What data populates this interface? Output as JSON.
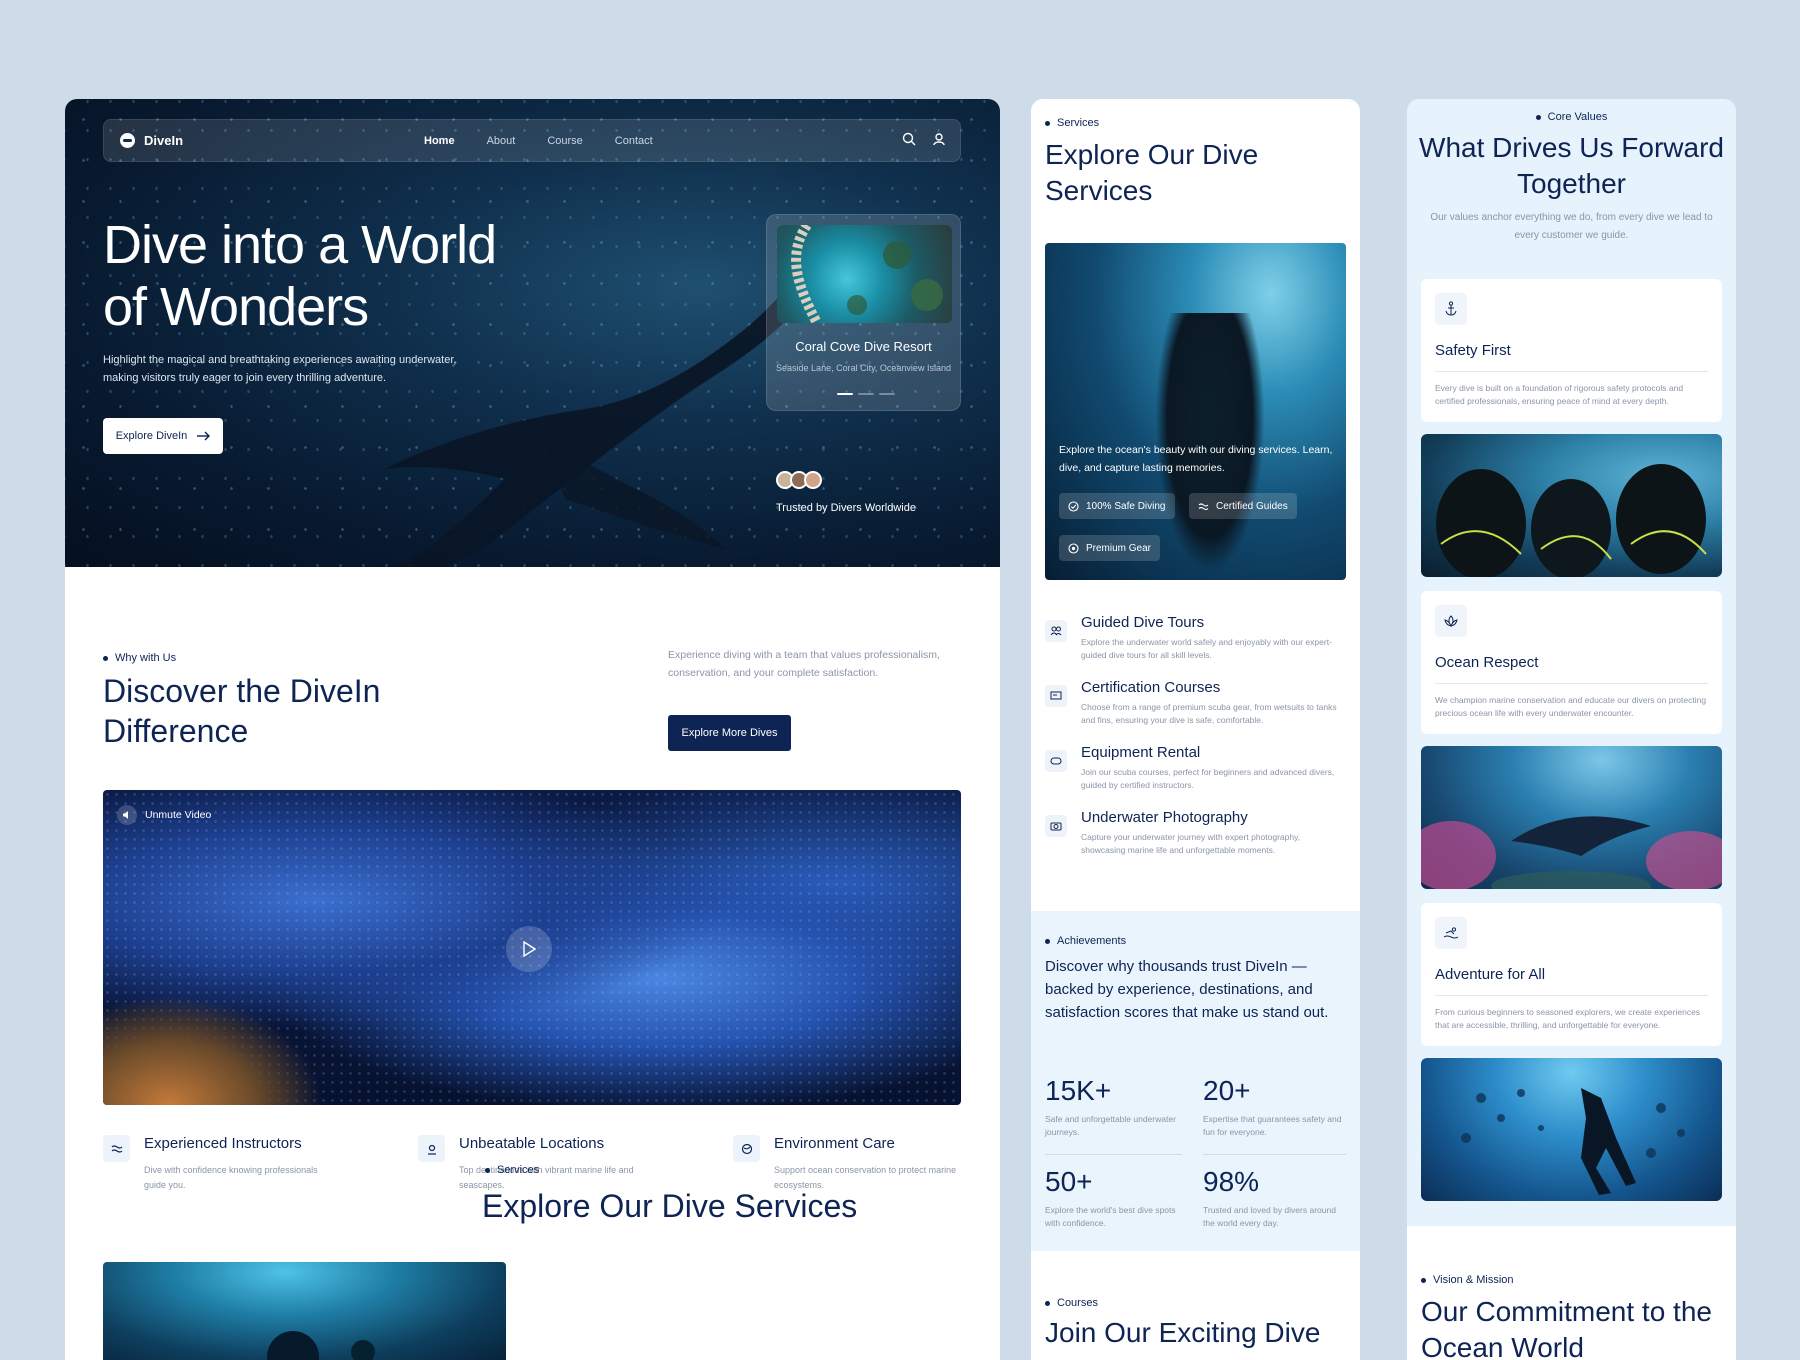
{
  "landing": {
    "brand": "DiveIn",
    "nav": [
      "Home",
      "About",
      "Course",
      "Contact"
    ],
    "hero_title": "Dive into a World of Wonders",
    "hero_text": "Highlight the magical and breathtaking experiences awaiting underwater, making visitors truly eager to join every thrilling adventure.",
    "hero_button": "Explore DiveIn",
    "resort_card": {
      "title": "Coral Cove Dive Resort",
      "address": "Seaside Lane, Coral City, Oceanview Island"
    },
    "trusted": "Trusted by Divers Worldwide",
    "why_label": "Why with Us",
    "why_title": "Discover the DiveIn Difference",
    "why_text": "Experience diving with a team that values professionalism, conservation, and your complete satisfaction.",
    "why_button": "Explore More Dives",
    "video_label": "Unmute Video",
    "features": [
      {
        "title": "Experienced Instructors",
        "desc": "Dive with confidence knowing professionals guide you."
      },
      {
        "title": "Unbeatable Locations",
        "desc": "Top destinations with vibrant marine life and seascapes."
      },
      {
        "title": "Environment Care",
        "desc": "Support ocean conservation to protect marine ecosystems."
      }
    ],
    "services_label": "Services",
    "services_title": "Explore Our Dive Services"
  },
  "services_page": {
    "label": "Services",
    "title": "Explore Our Dive Services",
    "image_text": "Explore the ocean's beauty with our diving services. Learn, dive, and capture lasting memories.",
    "pills": [
      "100% Safe Diving",
      "Certified Guides",
      "Premium Gear"
    ],
    "services": [
      {
        "title": "Guided Dive Tours",
        "desc": "Explore the underwater world safely and enjoyably with our expert-guided dive tours for all skill levels."
      },
      {
        "title": "Certification Courses",
        "desc": "Choose from a range of premium scuba gear, from wetsuits to tanks and fins, ensuring your dive is safe, comfortable."
      },
      {
        "title": "Equipment Rental",
        "desc": "Join our scuba courses, perfect for beginners and advanced divers, guided by certified instructors."
      },
      {
        "title": "Underwater Photography",
        "desc": "Capture your underwater journey with expert photography, showcasing marine life and unforgettable moments."
      }
    ],
    "achievements_label": "Achievements",
    "achievements_text": "Discover why thousands trust DiveIn — backed by experience, destinations, and satisfaction scores that make us stand out.",
    "stats": [
      {
        "value": "15K+",
        "desc": "Safe and unforgettable underwater journeys."
      },
      {
        "value": "20+",
        "desc": "Expertise that guarantees safety and fun for everyone."
      },
      {
        "value": "50+",
        "desc": "Explore the world's best dive spots with confidence."
      },
      {
        "value": "98%",
        "desc": "Trusted and loved by divers around the world every day."
      }
    ],
    "courses_label": "Courses",
    "courses_title": "Join Our Exciting Dive"
  },
  "values_page": {
    "label": "Core Values",
    "title": "What Drives Us Forward Together",
    "text": "Our values anchor everything we do, from every dive we lead to every customer we guide.",
    "values": [
      {
        "title": "Safety First",
        "desc": "Every dive is built on a foundation of rigorous safety protocols and certified professionals, ensuring peace of mind at every depth.",
        "icon": "anchor-icon"
      },
      {
        "title": "Ocean Respect",
        "desc": "We champion marine conservation and educate our divers on protecting precious ocean life with every underwater encounter.",
        "icon": "lotus-icon"
      },
      {
        "title": "Adventure for All",
        "desc": "From curious beginners to seasoned explorers, we create experiences that are accessible, thrilling, and unforgettable for everyone.",
        "icon": "swimmer-icon"
      }
    ],
    "vision_label": "Vision & Mission",
    "vision_title": "Our Commitment to the Ocean World"
  },
  "colors": {
    "navy": "#0d2454",
    "background": "#cddce8",
    "light_blue": "#e6f2fc"
  }
}
